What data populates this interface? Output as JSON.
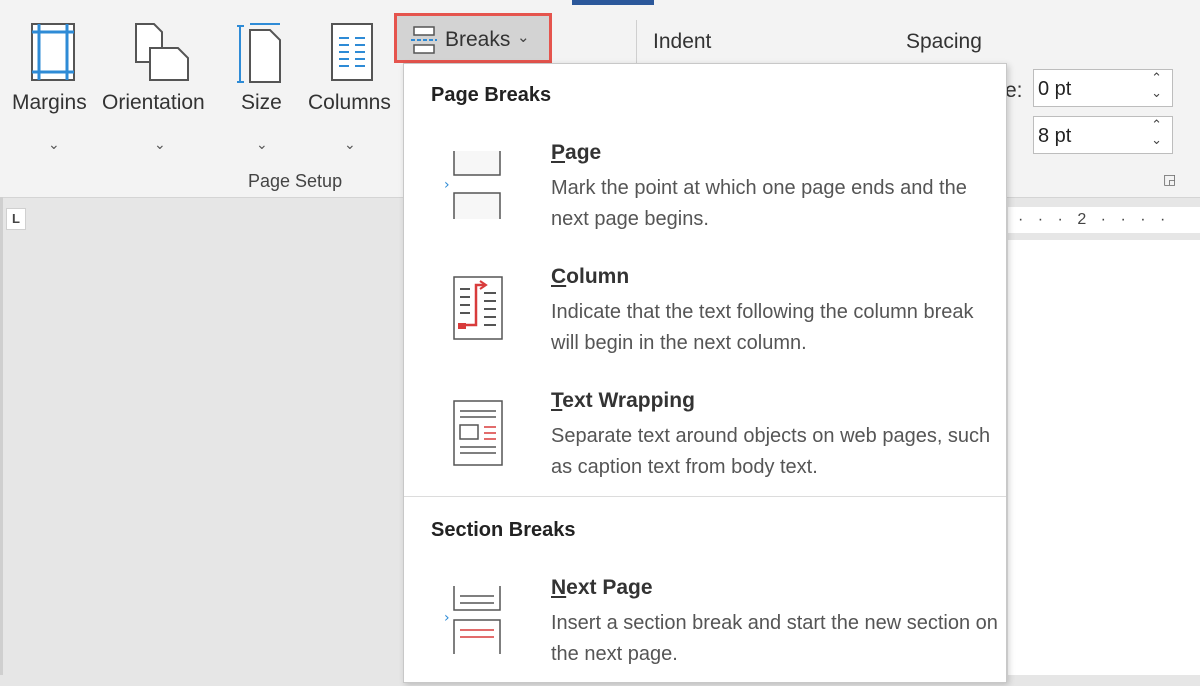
{
  "ribbon": {
    "margins_label": "Margins",
    "orientation_label": "Orientation",
    "size_label": "Size",
    "columns_label": "Columns",
    "breaks_label": "Breaks",
    "group_label": "Page Setup",
    "indent_header": "Indent",
    "spacing_header": "Spacing",
    "partial_label": "e:",
    "spacing_before": "0 pt",
    "spacing_after": "8 pt"
  },
  "ruler": {
    "text": "· · · 2 · · · ·"
  },
  "tab_stop": {
    "glyph": "L"
  },
  "menu": {
    "page_breaks_heading": "Page Breaks",
    "section_breaks_heading": "Section Breaks",
    "items": [
      {
        "title_first": "P",
        "title_rest": "age",
        "desc": "Mark the point at which one page ends and the next page begins."
      },
      {
        "title_first": "C",
        "title_rest": "olumn",
        "desc": "Indicate that the text following the column break will begin in the next column."
      },
      {
        "title_first": "T",
        "title_rest": "ext Wrapping",
        "desc": "Separate text around objects on web pages, such as caption text from body text."
      },
      {
        "title_first": "N",
        "title_rest": "ext Page",
        "desc": "Insert a section break and start the new section on the next page."
      }
    ]
  },
  "colors": {
    "accent_blue": "#2b579a",
    "icon_blue": "#2e8bd6",
    "highlight_red": "#e5544d",
    "break_red": "#d83b3b"
  },
  "icons": [
    "margins-icon",
    "orientation-icon",
    "size-icon",
    "columns-icon",
    "breaks-icon",
    "page-break-icon",
    "column-break-icon",
    "text-wrapping-icon",
    "next-page-icon"
  ]
}
